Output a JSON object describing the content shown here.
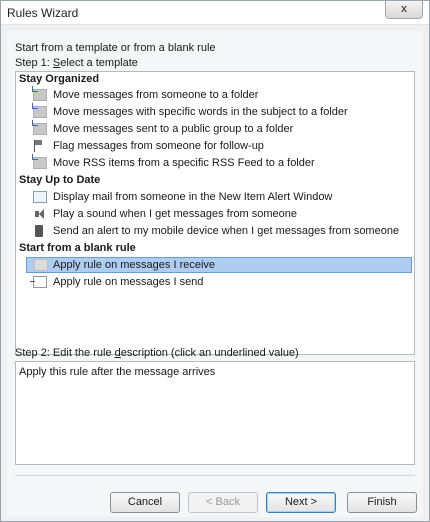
{
  "window": {
    "title": "Rules Wizard",
    "close_glyph": "x"
  },
  "intro_text": "Start from a template or from a blank rule",
  "step1": {
    "prefix": "Step 1: ",
    "underlined": "S",
    "rest": "elect a template"
  },
  "templates": {
    "groups": [
      {
        "header": "Stay Organized",
        "items": [
          {
            "label": "Move messages from someone to a folder",
            "icon": "folder-icon"
          },
          {
            "label": "Move messages with specific words in the subject to a folder",
            "icon": "folder-icon"
          },
          {
            "label": "Move messages sent to a public group to a folder",
            "icon": "folder-icon"
          },
          {
            "label": "Flag messages from someone for follow-up",
            "icon": "flag-icon"
          },
          {
            "label": "Move RSS items from a specific RSS Feed to a folder",
            "icon": "folder-icon"
          }
        ]
      },
      {
        "header": "Stay Up to Date",
        "items": [
          {
            "label": "Display mail from someone in the New Item Alert Window",
            "icon": "alert-window-icon"
          },
          {
            "label": "Play a sound when I get messages from someone",
            "icon": "speaker-icon"
          },
          {
            "label": "Send an alert to my mobile device when I get messages from someone",
            "icon": "mobile-device-icon"
          }
        ]
      },
      {
        "header": "Start from a blank rule",
        "items": [
          {
            "label": "Apply rule on messages I receive",
            "icon": "blank-rule-icon",
            "selected": true
          },
          {
            "label": "Apply rule on messages I send",
            "icon": "send-envelope-icon"
          }
        ]
      }
    ]
  },
  "step2": {
    "prefix": "Step 2: Edit the rule ",
    "underlined": "d",
    "rest": "escription (click an underlined value)"
  },
  "description_text": "Apply this rule after the message arrives",
  "buttons": {
    "cancel": "Cancel",
    "back": "< Back",
    "next": "Next >",
    "finish": "Finish"
  },
  "colors": {
    "selection_bg": "#aecdf0",
    "selection_border": "#6b9bd6"
  }
}
